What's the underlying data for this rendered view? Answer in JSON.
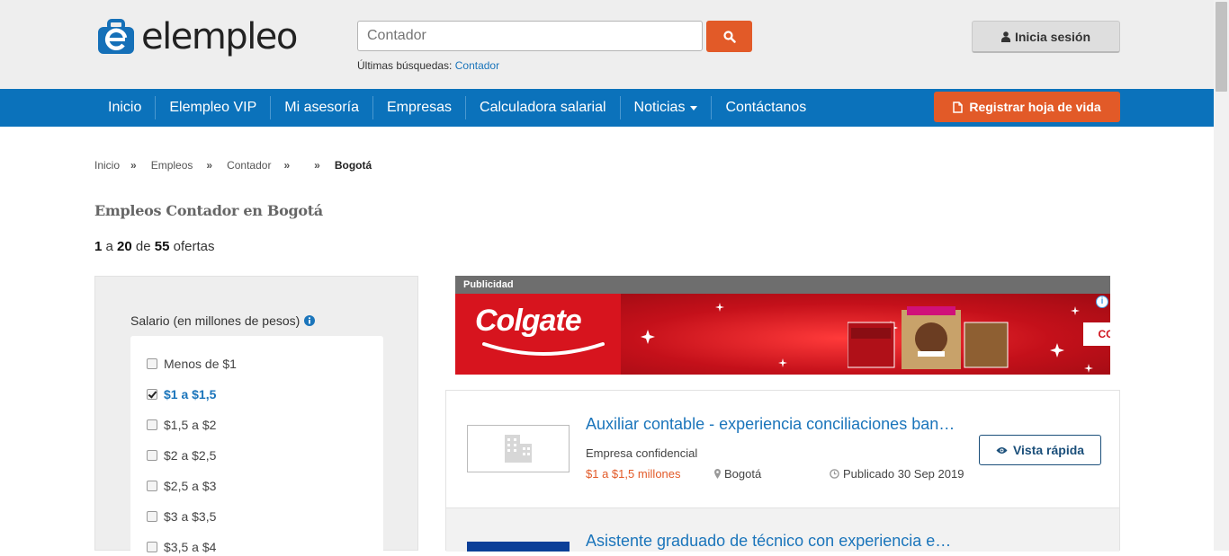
{
  "header": {
    "logo_text": "elempleo",
    "search_placeholder": "Contador",
    "recent_label": "Últimas búsquedas:",
    "recent_link": "Contador",
    "login_label": "Inicia sesión"
  },
  "nav": {
    "items": [
      "Inicio",
      "Elempleo VIP",
      "Mi asesoría",
      "Empresas",
      "Calculadora salarial",
      "Noticias",
      "Contáctanos"
    ],
    "register_label": "Registrar hoja de vida"
  },
  "breadcrumb": {
    "items": [
      "Inicio",
      "Empleos",
      "Contador",
      "",
      "Bogotá"
    ],
    "separator": "»"
  },
  "page": {
    "title": "Empleos Contador en Bogotá",
    "results": {
      "from": "1",
      "a": "a",
      "to": "20",
      "de": "de",
      "total": "55",
      "suffix": "ofertas"
    }
  },
  "filters": {
    "salary_title": "Salario (en millones de pesos)",
    "options": [
      "Menos de $1",
      "$1 a $1,5",
      "$1,5 a $2",
      "$2 a $2,5",
      "$2,5 a $3",
      "$3 a $3,5",
      "$3,5 a $4"
    ],
    "checked_index": 1
  },
  "ad": {
    "label": "Publicidad",
    "brand": "Colgate",
    "cta": "COMPRA Y BRILLA",
    "info_icon": "ⓘ",
    "brand_color": "#d0111b"
  },
  "jobs": [
    {
      "title": "Auxiliar contable - experiencia conciliaciones ban…",
      "company": "Empresa confidencial",
      "salary": "$1 a $1,5 millones",
      "city": "Bogotá",
      "date": "Publicado 30 Sep 2019",
      "button": "Vista rápida"
    },
    {
      "title": "Asistente graduado de técnico con experiencia e…"
    }
  ],
  "colors": {
    "accent": "#e25a28",
    "nav": "#0b72bb",
    "link": "#1b75bb"
  }
}
